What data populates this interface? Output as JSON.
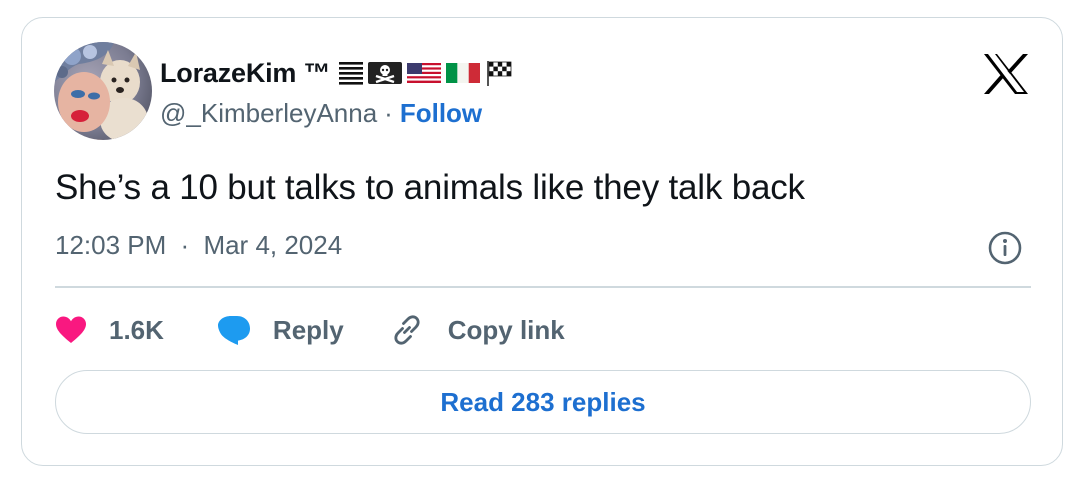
{
  "author": {
    "display_name": "LorazeKim ™",
    "handle": "@_KimberleyAnna",
    "separator": "·",
    "follow_label": "Follow",
    "emoji_icons": [
      "pride-flag-icon",
      "pirate-flag-icon",
      "us-flag-icon",
      "italy-flag-icon",
      "checkered-flag-icon"
    ]
  },
  "tweet": {
    "text": "She’s a 10 but talks to animals like they talk back",
    "time": "12:03 PM",
    "separator": "·",
    "date": "Mar 4, 2024"
  },
  "actions": {
    "like_count": "1.6K",
    "reply_label": "Reply",
    "copy_link_label": "Copy link"
  },
  "footer": {
    "read_replies_label": "Read 283 replies"
  },
  "colors": {
    "accent_blue": "#1d6fd0",
    "like_pink": "#f91880",
    "reply_bubble_blue": "#1d9bf0",
    "muted_text": "#536471",
    "border": "#cfd9de"
  }
}
